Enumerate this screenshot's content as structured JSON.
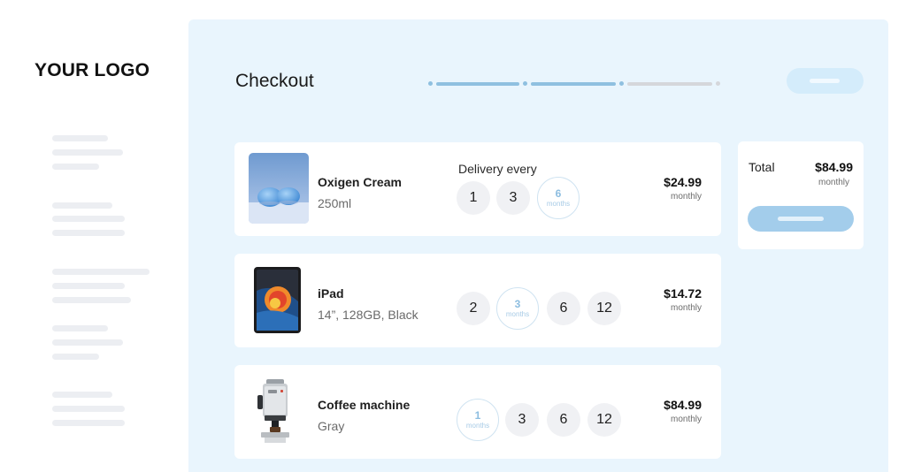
{
  "sidebar": {
    "logo": "YOUR LOGO"
  },
  "header": {
    "title": "Checkout"
  },
  "colors": {
    "accent": "#93c5e8",
    "panel": "#e9f5fd",
    "card": "#ffffff",
    "progress_done": "#8fc0e0",
    "progress_todo": "#d5d7db"
  },
  "progress": {
    "steps_total": 3,
    "steps_done": 2
  },
  "delivery": {
    "label": "Delivery every"
  },
  "products": [
    {
      "name": "Oxigen Cream",
      "detail": "250ml",
      "image": "cream-jars-image",
      "options": [
        {
          "num": "1",
          "unit": ""
        },
        {
          "num": "3",
          "unit": ""
        },
        {
          "num": "6",
          "unit": "months"
        }
      ],
      "selected": 2,
      "price": "$24.99",
      "period": "monthly"
    },
    {
      "name": "iPad",
      "detail": "14”, 128GB, Black",
      "image": "ipad-image",
      "options": [
        {
          "num": "2",
          "unit": ""
        },
        {
          "num": "3",
          "unit": "months"
        },
        {
          "num": "6",
          "unit": ""
        },
        {
          "num": "12",
          "unit": ""
        }
      ],
      "selected": 1,
      "price": "$14.72",
      "period": "monthly"
    },
    {
      "name": "Coffee machine",
      "detail": "Gray",
      "image": "coffee-machine-image",
      "options": [
        {
          "num": "1",
          "unit": "months"
        },
        {
          "num": "3",
          "unit": ""
        },
        {
          "num": "6",
          "unit": ""
        },
        {
          "num": "12",
          "unit": ""
        }
      ],
      "selected": 0,
      "price": "$84.99",
      "period": "monthly"
    }
  ],
  "summary": {
    "label": "Total",
    "amount": "$84.99",
    "period": "monthly"
  }
}
